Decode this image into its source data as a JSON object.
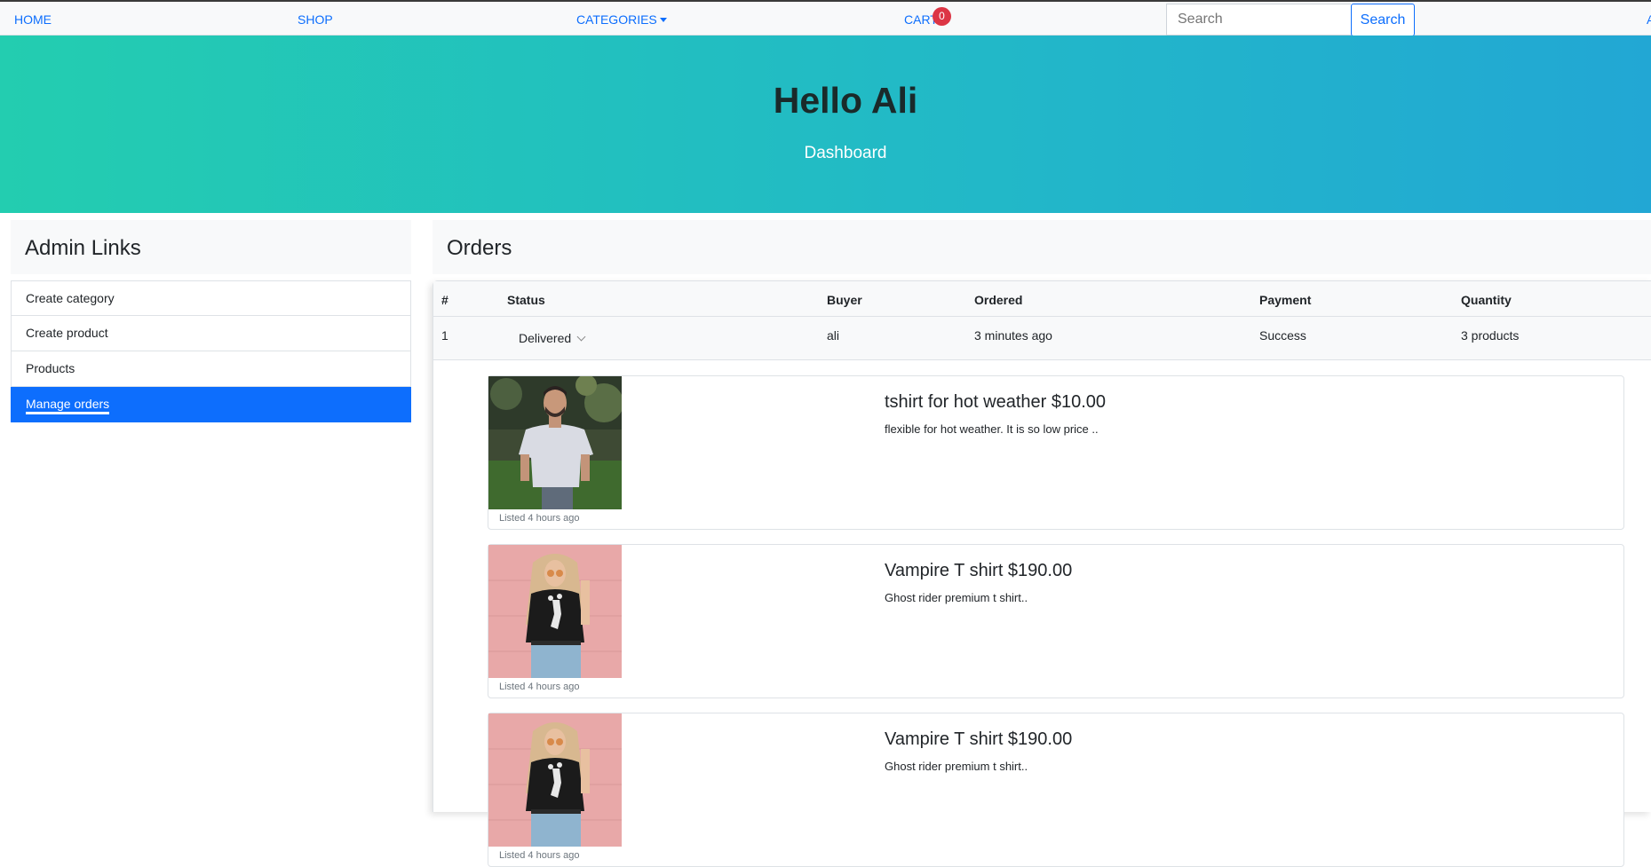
{
  "nav": {
    "home": "HOME",
    "shop": "SHOP",
    "categories": "CATEGORIES",
    "cart": "CART",
    "cart_count": "0",
    "search_placeholder": "Search",
    "search_button": "Search",
    "edge_text": "A"
  },
  "hero": {
    "title": "Hello Ali",
    "subtitle": "Dashboard"
  },
  "admin": {
    "title": "Admin Links",
    "items": [
      {
        "label": "Create category"
      },
      {
        "label": "Create product"
      },
      {
        "label": "Products"
      },
      {
        "label": "Manage orders"
      }
    ],
    "active_index": 3
  },
  "orders": {
    "title": "Orders",
    "columns": [
      "#",
      "Status",
      "Buyer",
      "Ordered",
      "Payment",
      "Quantity"
    ],
    "rows": [
      {
        "num": "1",
        "status": "Delivered",
        "buyer": "ali",
        "ordered": "3 minutes ago",
        "payment": "Success",
        "quantity": "3 products"
      }
    ],
    "products": [
      {
        "title": "tshirt for hot weather $10.00",
        "desc": "flexible for hot weather. It is so low price ..",
        "listed": "Listed 4 hours ago",
        "image": "white-tshirt-man"
      },
      {
        "title": "Vampire T shirt $190.00",
        "desc": "Ghost rider premium t shirt..",
        "listed": "Listed 4 hours ago",
        "image": "black-tshirt-woman"
      },
      {
        "title": "Vampire T shirt $190.00",
        "desc": "Ghost rider premium t shirt..",
        "listed": "Listed 4 hours ago",
        "image": "black-tshirt-woman"
      }
    ]
  },
  "colors": {
    "primary": "#0d6efd",
    "hero_start": "#23cdb0",
    "hero_end": "#22a7d4",
    "badge": "#dc3545"
  }
}
